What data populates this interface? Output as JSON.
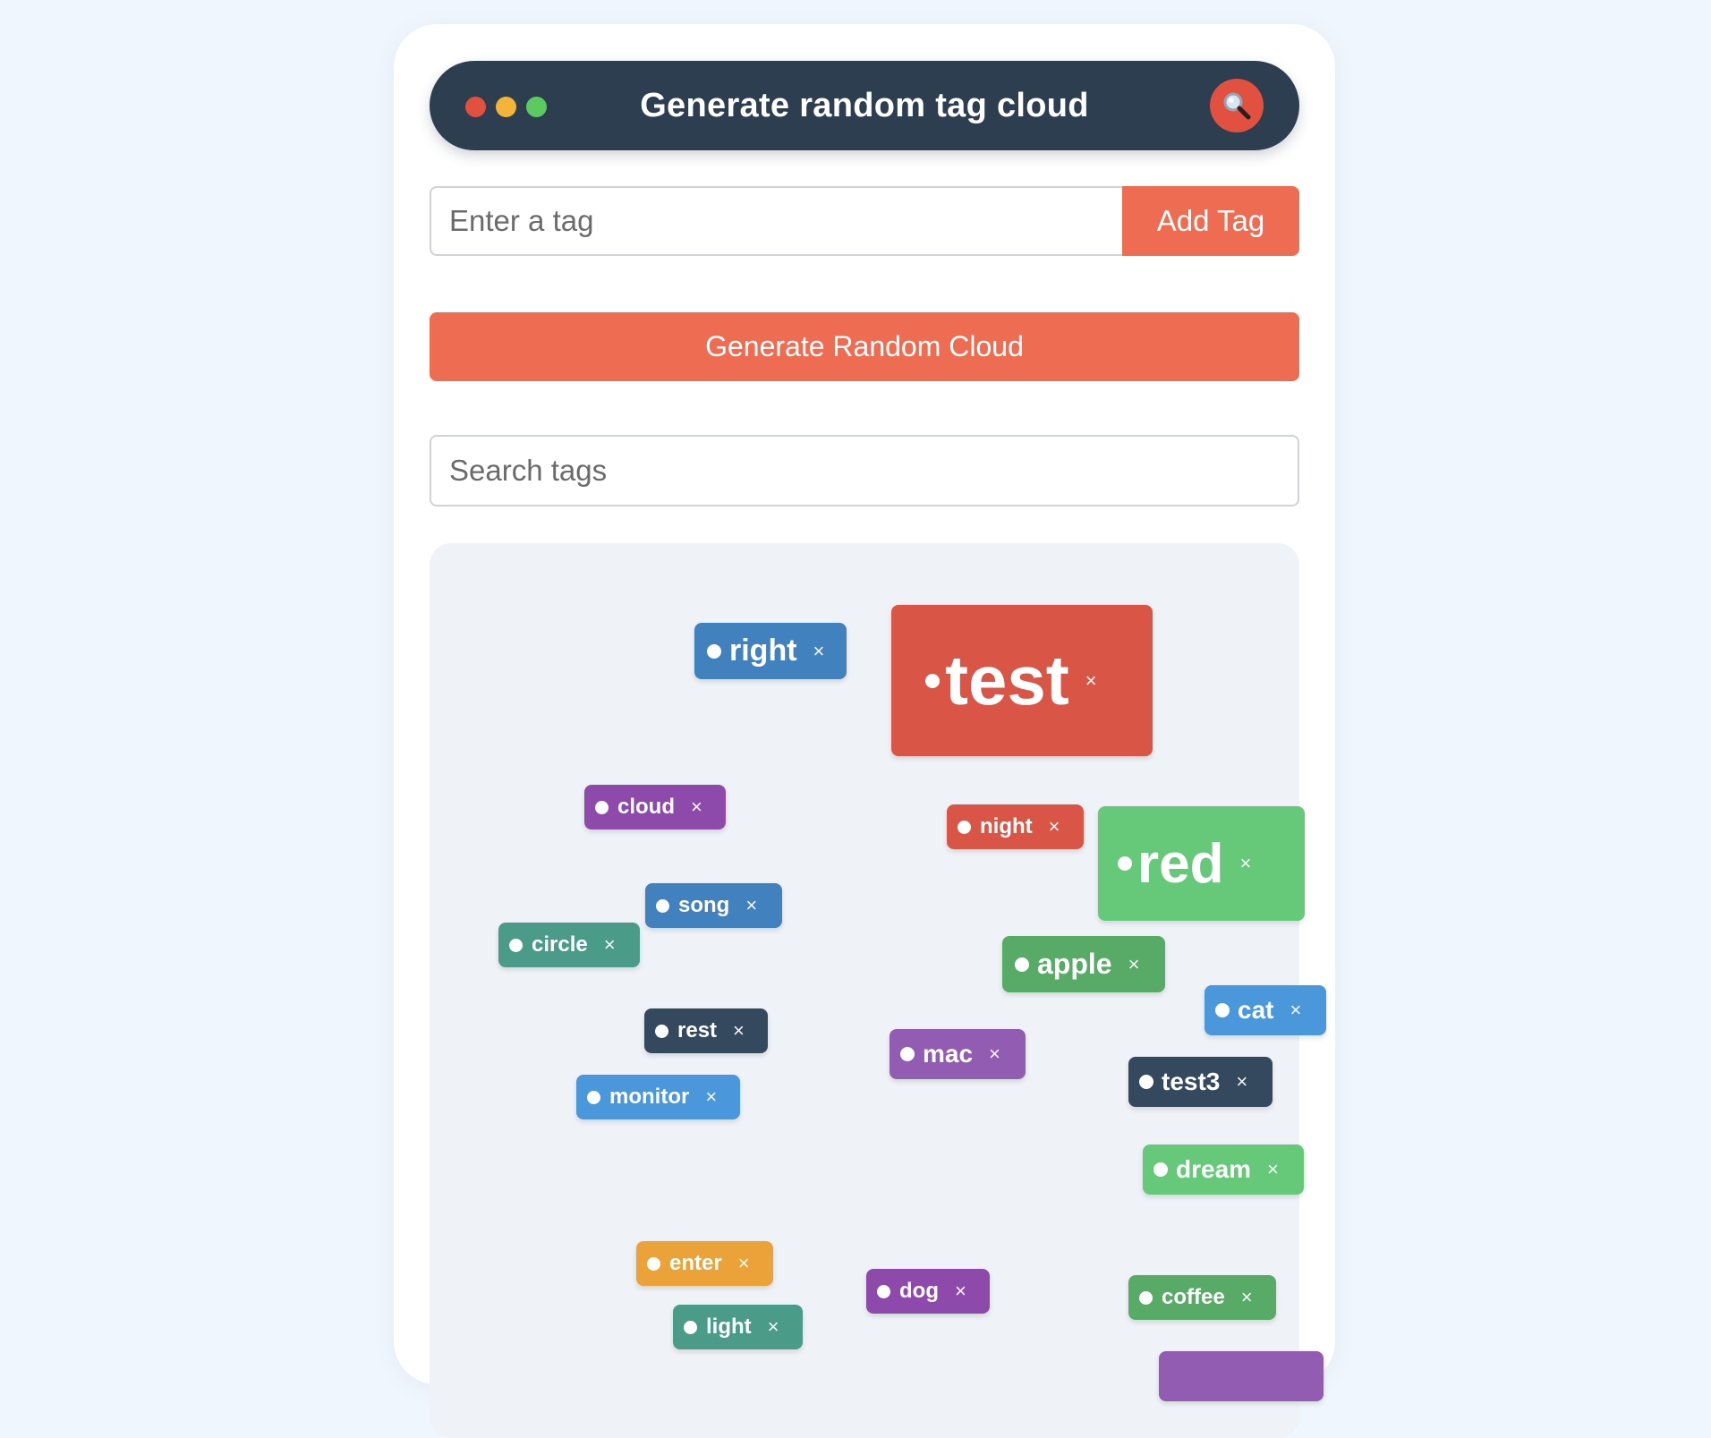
{
  "header": {
    "title": "Generate random tag cloud",
    "window_dots": [
      "#e2503f",
      "#f4b43a",
      "#5ccb5f"
    ],
    "search_icon": "magnifier-icon"
  },
  "tag_form": {
    "placeholder": "Enter a tag",
    "value": "",
    "add_label": "Add Tag"
  },
  "generate": {
    "label": "Generate Random Cloud"
  },
  "search": {
    "placeholder": "Search tags",
    "value": ""
  },
  "remove_symbol": "×",
  "tags": [
    {
      "text": "right",
      "color": "#4181bd"
    },
    {
      "text": "test",
      "color": "#d95646"
    },
    {
      "text": "cloud",
      "color": "#8e4aab"
    },
    {
      "text": "night",
      "color": "#d95646"
    },
    {
      "text": "red",
      "color": "#66c97a"
    },
    {
      "text": "song",
      "color": "#4181bd"
    },
    {
      "text": "circle",
      "color": "#4a9c88"
    },
    {
      "text": "apple",
      "color": "#58ab66"
    },
    {
      "text": "cat",
      "color": "#4a97dc"
    },
    {
      "text": "rest",
      "color": "#34495e"
    },
    {
      "text": "mac",
      "color": "#915cb1"
    },
    {
      "text": "test3",
      "color": "#34495e"
    },
    {
      "text": "monitor",
      "color": "#4a97dc"
    },
    {
      "text": "dream",
      "color": "#66c97a"
    },
    {
      "text": "enter",
      "color": "#eba239"
    },
    {
      "text": "dog",
      "color": "#8e4aab"
    },
    {
      "text": "coffee",
      "color": "#58ab66"
    },
    {
      "text": "light",
      "color": "#4a9c88"
    },
    {
      "text": "",
      "color": "#915cb1"
    }
  ]
}
